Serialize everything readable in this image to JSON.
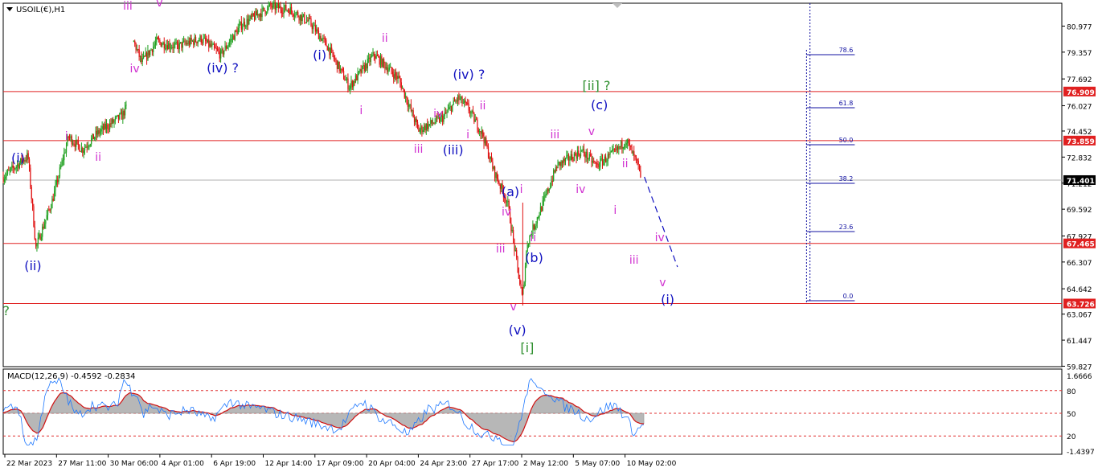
{
  "symbol_label": "USOIL(€),H1",
  "indicator_label": "MACD(12,26,9) -0.4592 -0.2834",
  "colors": {
    "bull": "#20a020",
    "bear": "#e01010",
    "level_line": "#e02020",
    "current_line": "#b0b0b0",
    "wave_blue": "#1010c0",
    "wave_magenta": "#d030d0",
    "wave_green": "#309030",
    "fib_line": "#1010a0",
    "macd_line": "#1e78ff",
    "macd_signal": "#d01010",
    "macd_hist": "#b0b0b0",
    "price_tag_bg": "#e02020",
    "current_tag_bg": "#000000"
  },
  "chart_data": {
    "type": "candlestick",
    "timeframe": "H1",
    "y_range": [
      59.8,
      82.4
    ],
    "price_ticks": [
      "80.977",
      "79.357",
      "77.692",
      "76.027",
      "74.452",
      "72.832",
      "71.212",
      "69.592",
      "67.927",
      "66.307",
      "64.642",
      "63.067",
      "61.447",
      "59.827"
    ],
    "x_ticks": [
      "22 Mar 2023",
      "27 Mar 11:00",
      "30 Mar 06:00",
      "4 Apr 01:00",
      "6 Apr 19:00",
      "12 Apr 14:00",
      "17 Apr 09:00",
      "20 Apr 04:00",
      "24 Apr 23:00",
      "27 Apr 17:00",
      "2 May 12:00",
      "5 May 07:00",
      "10 May 02:00"
    ],
    "levels": [
      {
        "price": 76.909,
        "label": "76.909"
      },
      {
        "price": 73.859,
        "label": "73.859"
      },
      {
        "price": 67.465,
        "label": "67.465"
      },
      {
        "price": 63.726,
        "label": "63.726"
      }
    ],
    "current_price": {
      "price": 71.401,
      "label": "71.401"
    },
    "price_path": [
      {
        "t": 0,
        "p": 71.6
      },
      {
        "t": 0.025,
        "p": 72.9
      },
      {
        "t": 0.033,
        "p": 67.2
      },
      {
        "t": 0.05,
        "p": 70.2
      },
      {
        "t": 0.066,
        "p": 74.1
      },
      {
        "t": 0.08,
        "p": 73.3
      },
      {
        "t": 0.095,
        "p": 74.3
      },
      {
        "t": 0.12,
        "p": 75.4
      },
      {
        "t": 0.125,
        "p": 76.0
      }
    ],
    "price_path_2": [
      {
        "t": 0.132,
        "p": 80.0
      },
      {
        "t": 0.14,
        "p": 78.7
      },
      {
        "t": 0.155,
        "p": 80.0
      },
      {
        "t": 0.175,
        "p": 79.7
      },
      {
        "t": 0.2,
        "p": 80.2
      },
      {
        "t": 0.22,
        "p": 79.2
      },
      {
        "t": 0.24,
        "p": 81.0
      },
      {
        "t": 0.27,
        "p": 82.2
      },
      {
        "t": 0.29,
        "p": 82.0
      },
      {
        "t": 0.31,
        "p": 81.2
      },
      {
        "t": 0.328,
        "p": 79.7
      },
      {
        "t": 0.35,
        "p": 77.2
      },
      {
        "t": 0.375,
        "p": 79.2
      },
      {
        "t": 0.4,
        "p": 77.7
      },
      {
        "t": 0.42,
        "p": 74.5
      },
      {
        "t": 0.445,
        "p": 75.3
      },
      {
        "t": 0.46,
        "p": 76.5
      },
      {
        "t": 0.47,
        "p": 75.9
      },
      {
        "t": 0.485,
        "p": 74.2
      },
      {
        "t": 0.496,
        "p": 72.0
      },
      {
        "t": 0.51,
        "p": 70.0
      },
      {
        "t": 0.525,
        "p": 64.0
      },
      {
        "t": 0.53,
        "p": 67.5
      },
      {
        "t": 0.545,
        "p": 69.8
      },
      {
        "t": 0.56,
        "p": 72.3
      },
      {
        "t": 0.585,
        "p": 73.2
      },
      {
        "t": 0.6,
        "p": 72.3
      },
      {
        "t": 0.62,
        "p": 73.2
      },
      {
        "t": 0.63,
        "p": 73.9
      },
      {
        "t": 0.6425,
        "p": 72.2
      },
      {
        "t": 0.645,
        "p": 71.2
      }
    ],
    "projection": [
      {
        "t": 0.6485,
        "p": 71.6
      },
      {
        "t": 0.682,
        "p": 66.0
      }
    ],
    "fib_levels": [
      {
        "label": "78.6",
        "price": 79.2
      },
      {
        "label": "61.8",
        "price": 75.9
      },
      {
        "label": "50.0",
        "price": 73.6
      },
      {
        "label": "38.2",
        "price": 71.2
      },
      {
        "label": "23.6",
        "price": 68.2
      },
      {
        "label": "0.0",
        "price": 63.9
      }
    ],
    "wave_labels": [
      {
        "text": "(i)",
        "t": 0.015,
        "p": 72.5,
        "color": "wave_blue"
      },
      {
        "text": "(ii)",
        "t": 0.03,
        "p": 65.8,
        "color": "wave_blue"
      },
      {
        "text": "i",
        "t": 0.064,
        "p": 73.9,
        "color": "wave_magenta"
      },
      {
        "text": "ii",
        "t": 0.096,
        "p": 72.6,
        "color": "wave_magenta"
      },
      {
        "text": "?",
        "t": 0.003,
        "p": 63.0,
        "color": "wave_green"
      },
      {
        "text": "iii",
        "t": 0.126,
        "p": 82.0,
        "color": "wave_magenta"
      },
      {
        "text": "v",
        "t": 0.158,
        "p": 82.2,
        "color": "wave_magenta"
      },
      {
        "text": "iv",
        "t": 0.133,
        "p": 78.1,
        "color": "wave_magenta"
      },
      {
        "text": "(iv) ?",
        "t": 0.222,
        "p": 78.1,
        "color": "wave_blue"
      },
      {
        "text": "(i)",
        "t": 0.32,
        "p": 78.9,
        "color": "wave_blue"
      },
      {
        "text": "ii",
        "t": 0.386,
        "p": 80.0,
        "color": "wave_magenta"
      },
      {
        "text": "i",
        "t": 0.362,
        "p": 75.5,
        "color": "wave_magenta"
      },
      {
        "text": "iii",
        "t": 0.42,
        "p": 73.1,
        "color": "wave_magenta"
      },
      {
        "text": "iv",
        "t": 0.44,
        "p": 75.3,
        "color": "wave_magenta"
      },
      {
        "text": "(iii)",
        "t": 0.455,
        "p": 73.0,
        "color": "wave_blue"
      },
      {
        "text": "i",
        "t": 0.47,
        "p": 74.0,
        "color": "wave_magenta"
      },
      {
        "text": "(iv) ?",
        "t": 0.471,
        "p": 77.7,
        "color": "wave_blue"
      },
      {
        "text": "ii",
        "t": 0.485,
        "p": 75.8,
        "color": "wave_magenta"
      },
      {
        "text": "(a)",
        "t": 0.513,
        "p": 70.4,
        "color": "wave_blue"
      },
      {
        "text": "i",
        "t": 0.524,
        "p": 70.6,
        "color": "wave_magenta"
      },
      {
        "text": "iv",
        "t": 0.509,
        "p": 69.2,
        "color": "wave_magenta"
      },
      {
        "text": "iii",
        "t": 0.503,
        "p": 66.9,
        "color": "wave_magenta"
      },
      {
        "text": "ii",
        "t": 0.536,
        "p": 67.6,
        "color": "wave_magenta"
      },
      {
        "text": "(b)",
        "t": 0.537,
        "p": 66.3,
        "color": "wave_blue"
      },
      {
        "text": "v",
        "t": 0.516,
        "p": 63.3,
        "color": "wave_magenta"
      },
      {
        "text": "(v)",
        "t": 0.52,
        "p": 61.8,
        "color": "wave_blue"
      },
      {
        "text": "[i]",
        "t": 0.53,
        "p": 60.7,
        "color": "wave_green"
      },
      {
        "text": "iii",
        "t": 0.558,
        "p": 74.0,
        "color": "wave_magenta"
      },
      {
        "text": "[ii] ?",
        "t": 0.6,
        "p": 77.0,
        "color": "wave_green"
      },
      {
        "text": "(c)",
        "t": 0.603,
        "p": 75.8,
        "color": "wave_blue"
      },
      {
        "text": "v",
        "t": 0.595,
        "p": 74.2,
        "color": "wave_magenta"
      },
      {
        "text": "iv",
        "t": 0.584,
        "p": 70.6,
        "color": "wave_magenta"
      },
      {
        "text": "ii",
        "t": 0.629,
        "p": 72.2,
        "color": "wave_magenta"
      },
      {
        "text": "i",
        "t": 0.619,
        "p": 69.3,
        "color": "wave_magenta"
      },
      {
        "text": "iii",
        "t": 0.638,
        "p": 66.2,
        "color": "wave_magenta"
      },
      {
        "text": "iv",
        "t": 0.664,
        "p": 67.6,
        "color": "wave_magenta"
      },
      {
        "text": "v",
        "t": 0.667,
        "p": 64.8,
        "color": "wave_magenta"
      },
      {
        "text": "(i)",
        "t": 0.672,
        "p": 63.7,
        "color": "wave_blue"
      }
    ],
    "macd": {
      "value": -0.4592,
      "signal": -0.2834,
      "axis_labels": [
        "1.6666",
        "80",
        "50",
        "20",
        "-1.4397"
      ]
    }
  }
}
